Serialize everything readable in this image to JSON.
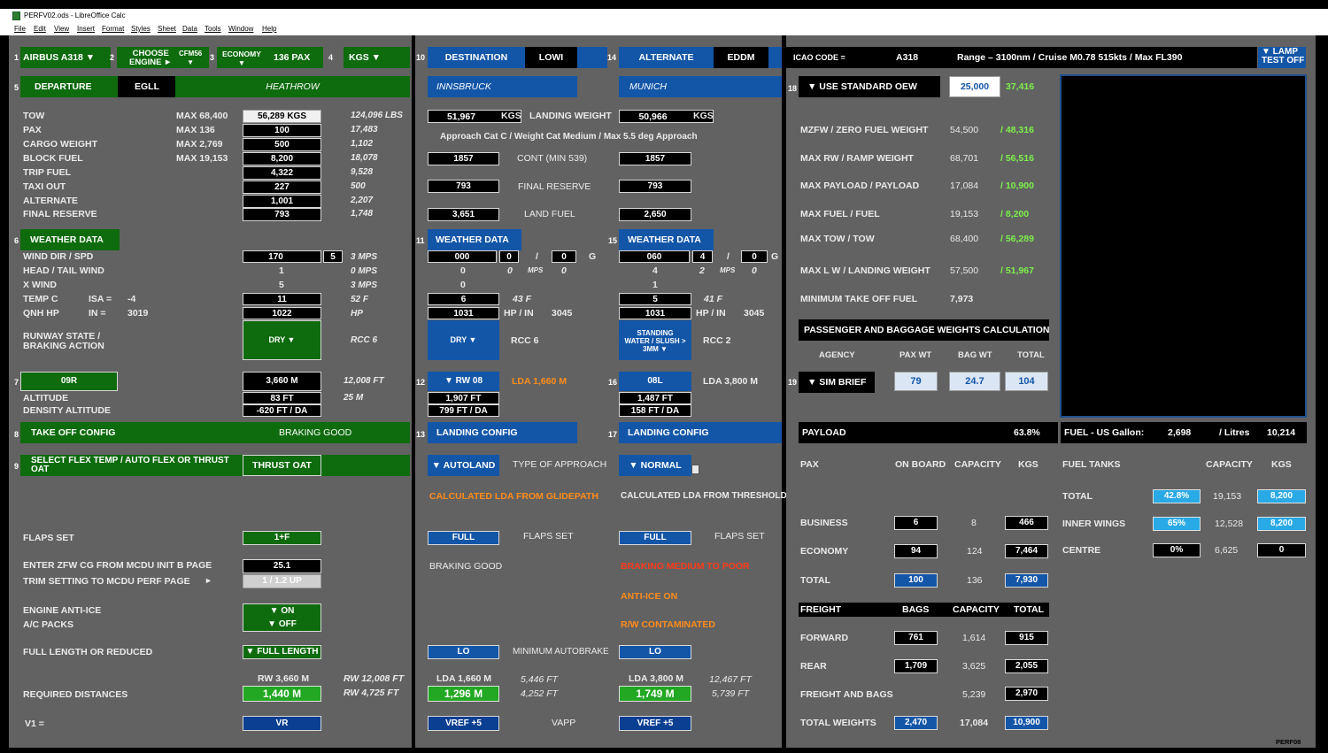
{
  "window": {
    "title": "PERFV02.ods - LibreOffice Calc"
  },
  "menu": [
    "File",
    "Edit",
    "View",
    "Insert",
    "Format",
    "Styles",
    "Sheet",
    "Data",
    "Tools",
    "Window",
    "Help"
  ],
  "n": {
    "n1": "1",
    "n2": "2",
    "n3": "3",
    "n4": "4",
    "n5": "5",
    "n6": "6",
    "n7": "7",
    "n8": "8",
    "n9": "9",
    "n10": "10",
    "n11": "11",
    "n12": "12",
    "n13": "13",
    "n14": "14",
    "n15": "15",
    "n16": "16",
    "n17": "17",
    "n18": "18",
    "n19": "19"
  },
  "dep": {
    "aircraft": "AIRBUS A318 ▼",
    "choose_engine": "CHOOSE\nENGINE ►",
    "engine": "CFM56\n▼",
    "cabin": "ECONOMY\n▼",
    "pax": "136 PAX",
    "units": "KGS ▼",
    "departure": "DEPARTURE",
    "dep_icao": "EGLL",
    "dep_name": "HEATHROW",
    "rows": [
      {
        "label": "TOW",
        "max": "MAX 68,400",
        "val": "56,289 KGS",
        "lbs": "124,096 LBS"
      },
      {
        "label": "PAX",
        "max": "MAX 136",
        "val": "100",
        "lbs": "17,483"
      },
      {
        "label": "CARGO WEIGHT",
        "max": "MAX 2,769",
        "val": "500",
        "lbs": "1,102"
      },
      {
        "label": "BLOCK FUEL",
        "max": "MAX 19,153",
        "val": "8,200",
        "lbs": "18,078"
      },
      {
        "label": "TRIP FUEL",
        "max": "",
        "val": "4,322",
        "lbs": "9,528"
      },
      {
        "label": "TAXI OUT",
        "max": "",
        "val": "227",
        "lbs": "500"
      },
      {
        "label": "ALTERNATE",
        "max": "",
        "val": "1,001",
        "lbs": "2,207"
      },
      {
        "label": "FINAL RESERVE",
        "max": "",
        "val": "793",
        "lbs": "1,748"
      }
    ],
    "weather_data": "WEATHER DATA",
    "wind_lbl": "WIND DIR  / SPD",
    "wind_dir": "170",
    "wind_spd": "5",
    "wind_mps": "3 MPS",
    "ht_lbl": "HEAD / TAIL WIND",
    "ht_val": "1",
    "ht_mps": "0 MPS",
    "xw_lbl": "X WIND",
    "xw_val": "5",
    "xw_mps": "3 MPS",
    "temp_lbl": "TEMP  C",
    "isa_lbl": "ISA  =",
    "isa_val": "-4",
    "temp_val": "11",
    "temp_f": "52 F",
    "qnh_lbl": "QNH  HP",
    "in_lbl": "IN   =",
    "in_val": "3019",
    "qnh_val": "1022",
    "hp": "HP",
    "rwy_state_lbl": "RUNWAY STATE /\nBRAKING ACTION",
    "rwy_state": "DRY ▼",
    "rcc": "RCC 6",
    "rwy": "09R",
    "rwy_len": "3,660 M",
    "rwy_ft": "12,008 FT",
    "alt_lbl": "ALTITUDE",
    "alt_val": "83 FT",
    "alt_m": "25 M",
    "da_lbl": "DENSITY ALTITUDE",
    "da_val": "-620 FT / DA",
    "to_config": "TAKE OFF CONFIG",
    "braking_good": "BRAKING GOOD",
    "flex_lbl": "SELECT FLEX TEMP / AUTO FLEX OR THRUST\nOAT",
    "flex_val": "THRUST OAT",
    "flaps_lbl": "FLAPS SET",
    "flaps_val": "1+F",
    "zfwcg_lbl": "ENTER ZFW CG FROM MCDU INIT B PAGE",
    "zfwcg_val": "25.1",
    "trim_lbl": "TRIM SETTING TO MCDU PERF PAGE",
    "trim_arrow": "►",
    "trim_val": "1  /  1.2   UP",
    "anti_ice_lbl": "ENGINE ANTI-ICE",
    "anti_ice_val": "▼ ON",
    "packs_lbl": "A/C PACKS",
    "packs_val": "▼ OFF",
    "fl_lbl": "FULL LENGTH OR REDUCED",
    "fl_val": "▼ FULL LENGTH",
    "rw_m": "RW 3,660 M",
    "rw_ft": "RW 12,008 FT",
    "rw_ft2": "RW 4,725 FT",
    "req_lbl": "REQUIRED DISTANCES",
    "req_val": "1,440 M",
    "v1_lbl": "V1 =",
    "vr": "VR"
  },
  "dest": {
    "destination": "DESTINATION",
    "dest_icao": "LOWI",
    "dest_name": "INNSBRUCK",
    "alternate": "ALTERNATE",
    "alt_icao": "EDDM",
    "alt_name": "MUNICH",
    "lw1": "51,967",
    "lw_kgs": "KGS",
    "lw_lbl": "LANDING WEIGHT",
    "lw2": "50,966",
    "lw_kgs2": "KGS",
    "approach": "Approach Cat C / Weight Cat Medium / Max 5.5 deg Approach",
    "cont1": "1857",
    "cont_lbl": "CONT   (MIN   539)",
    "cont2": "1857",
    "fr1": "793",
    "fr_lbl": "FINAL RESERVE",
    "fr2": "793",
    "lf1": "3,651",
    "lf_lbl": "LAND FUEL",
    "lf2": "2,650",
    "wx": "WEATHER DATA",
    "w1_dir": "000",
    "w1_spd": "0",
    "slash": "/",
    "w1_g": "0",
    "g": "G",
    "w1_a": "0",
    "w1_b": "0",
    "mps": "MPS",
    "w1_c": "0",
    "w1_d": "0",
    "w1_temp": "6",
    "w1_f": "43 F",
    "w1_qnh": "1031",
    "hp_in": "HP  /  IN",
    "w1_in": "3045",
    "w1_state": "DRY ▼",
    "w1_rcc": "RCC 6",
    "w2_dir": "060",
    "w2_spd": "4",
    "w2_g": "0",
    "w2_a": "4",
    "w2_b": "2",
    "w2_c": "0",
    "w2_d": "1",
    "w2_temp": "5",
    "w2_f": "41 F",
    "w2_qnh": "1031",
    "w2_in": "3045",
    "w2_state": "STANDING\nWATER / SLUSH >\n3MM ▼",
    "w2_rcc": "RCC 2",
    "rw1": "▼  RW  08",
    "lda1": "LDA 1,660 M",
    "rw1_alt": "1,907 FT",
    "rw1_da": "799 FT / DA",
    "rw2": "08L",
    "lda2": "LDA 3,800 M",
    "rw2_alt": "1,487 FT",
    "rw2_da": "158 FT / DA",
    "lc1": "LANDING CONFIG",
    "lc2": "LANDING CONFIG",
    "autoland": "▼ AUTOLAND",
    "toa": "TYPE OF APPROACH",
    "normal": "▼ NORMAL",
    "calc1": "CALCULATED LDA FROM GLIDEPATH",
    "calc2": "CALCULATED LDA FROM THRESHOLD",
    "full1": "FULL",
    "flaps_set": "FLAPS SET",
    "full2": "FULL",
    "flaps_set2": "FLAPS SET",
    "bg": "BRAKING GOOD",
    "bmp": "BRAKING MEDIUM TO POOR",
    "anti_ice": "ANTI-ICE ON",
    "rwc": "R/W CONTAMINATED",
    "lo1": "LO",
    "min_ab": "MINIMUM AUTOBRAKE",
    "lo2": "LO",
    "lda_a": "LDA 1,660 M",
    "ft_a1": "5,446 FT",
    "ft_a2": "4,252 FT",
    "res_a": "1,296 M",
    "lda_b": "LDA 3,800 M",
    "ft_b1": "12,467 FT",
    "ft_b2": "5,739 FT",
    "res_b": "1,749 M",
    "vref1": "VREF +5",
    "vapp": "VAPP",
    "vref2": "VREF +5"
  },
  "wt": {
    "icao_lbl": "ICAO  CODE    =",
    "icao": "A318",
    "range": "Range – 3100nm / Cruise M0.78 515kts / Max FL390",
    "lamp": "▼ LAMP\nTEST OFF",
    "oew_lbl": "▼ USE STANDARD OEW",
    "oew": "25,000",
    "oew2": "37,416",
    "rows": [
      {
        "label": "MZFW / ZERO FUEL WEIGHT",
        "max": "54,500",
        "val": "/ 48,316"
      },
      {
        "label": "MAX RW / RAMP WEIGHT",
        "max": "68,701",
        "val": "/ 56,516"
      },
      {
        "label": "MAX PAYLOAD / PAYLOAD",
        "max": "17,084",
        "val": "/ 10,900"
      },
      {
        "label": "MAX FUEL / FUEL",
        "max": "19,153",
        "val": "/ 8,200"
      },
      {
        "label": "MAX TOW  / TOW",
        "max": "68,400",
        "val": "/ 56,289"
      },
      {
        "label": "MAX L W / LANDING WEIGHT",
        "max": "57,500",
        "val": "/ 51,967"
      }
    ],
    "mtof_lbl": "MINIMUM TAKE OFF FUEL",
    "mtof": "7,973",
    "pbw": "PASSENGER AND BAGGAGE WEIGHTS CALCULATION",
    "agency_h": "AGENCY",
    "paxwt_h": "PAX WT",
    "bagwt_h": "BAG WT",
    "total_h": "TOTAL",
    "agency": "▼ SIM BRIEF",
    "paxwt": "79",
    "bagwt": "24.7",
    "total": "104",
    "payload": "PAYLOAD",
    "payload_pct": "63.8%",
    "pax_h": "PAX",
    "onboard_h": "ON BOARD",
    "capacity_h": "CAPACITY",
    "kgs_h": "KGS",
    "pax_rows": [
      {
        "label": "BUSINESS",
        "ob": "6",
        "cap": "8",
        "kgs": "466"
      },
      {
        "label": "ECONOMY",
        "ob": "94",
        "cap": "124",
        "kgs": "7,464"
      },
      {
        "label": "TOTAL",
        "ob": "100",
        "cap": "136",
        "kgs": "7,930"
      }
    ],
    "freight_h": "FREIGHT",
    "bags_h": "BAGS",
    "fcap_h": "CAPACITY",
    "ftot_h": "TOTAL",
    "fr_rows": [
      {
        "label": "FORWARD",
        "bags": "761",
        "cap": "1,614",
        "tot": "915"
      },
      {
        "label": "REAR",
        "bags": "1,709",
        "cap": "3,625",
        "tot": "2,055"
      }
    ],
    "fab_lbl": "FREIGHT AND BAGS",
    "fab_cap": "5,239",
    "fab_tot": "2,970",
    "tw_lbl": "TOTAL WEIGHTS",
    "tw_bags": "2,470",
    "tw_cap": "17,084",
    "tw_tot": "10,900",
    "fuel_lbl": "FUEL  -  US  Gallon:",
    "gal": "2,698",
    "litres_lbl": "/   Litres",
    "litres": "10,214",
    "ft_h": "FUEL TANKS",
    "ftcap_h": "CAPACITY",
    "ftkgs_h": "KGS",
    "ft_rows": [
      {
        "label": "TOTAL",
        "pct": "42.8%",
        "cap": "19,153",
        "kgs": "8,200"
      },
      {
        "label": "INNER WINGS",
        "pct": "65%",
        "cap": "12,528",
        "kgs": "8,200"
      },
      {
        "label": "CENTRE",
        "pct": "0%",
        "cap": "6,625",
        "kgs": "0"
      }
    ],
    "perf": "PERF08"
  }
}
